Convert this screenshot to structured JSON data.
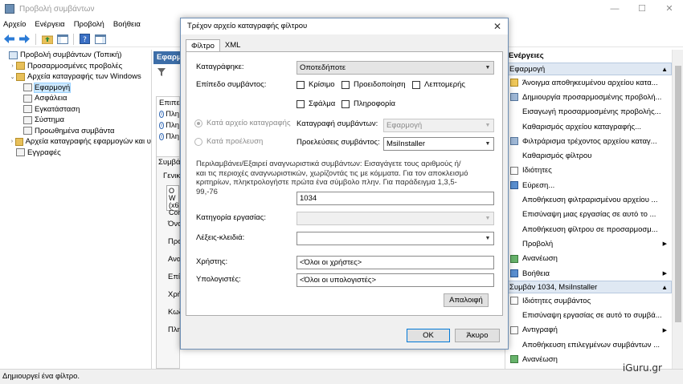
{
  "window": {
    "title": "Προβολή συμβάντων",
    "controls": [
      "—",
      "☐",
      "✕"
    ]
  },
  "menu": [
    "Αρχείο",
    "Ενέργεια",
    "Προβολή",
    "Βοήθεια"
  ],
  "tree": [
    {
      "label": "Προβολή συμβάντων (Τοπική)",
      "indent": 0,
      "arrow": "",
      "icon": "view"
    },
    {
      "label": "Προσαρμοσμένες προβολές",
      "indent": 1,
      "arrow": "›",
      "icon": "folder"
    },
    {
      "label": "Αρχεία καταγραφής των Windows",
      "indent": 1,
      "arrow": "⌄",
      "icon": "folder"
    },
    {
      "label": "Εφαρμογή",
      "indent": 2,
      "arrow": "",
      "icon": "log",
      "selected": true
    },
    {
      "label": "Ασφάλεια",
      "indent": 2,
      "arrow": "",
      "icon": "log"
    },
    {
      "label": "Εγκατάσταση",
      "indent": 2,
      "arrow": "",
      "icon": "log"
    },
    {
      "label": "Σύστημα",
      "indent": 2,
      "arrow": "",
      "icon": "log"
    },
    {
      "label": "Προωθημένα συμβάντα",
      "indent": 2,
      "arrow": "",
      "icon": "log"
    },
    {
      "label": "Αρχεία καταγραφής εφαρμογών και υ",
      "indent": 1,
      "arrow": "›",
      "icon": "folder"
    },
    {
      "label": "Εγγραφές",
      "indent": 1,
      "arrow": "",
      "icon": "log"
    }
  ],
  "middle": {
    "header": "Εφαρμ",
    "col_header": "Επιπεδ",
    "rows": [
      "Πλη",
      "Πλη",
      "Πλη"
    ],
    "detail_header": "Συμβάν",
    "detail_tab": "Γενικ",
    "detail_box": [
      "O W",
      "(x6",
      "Con"
    ],
    "detail_labels": [
      "Όνο",
      "Προ",
      "Ανα",
      "Επίπ",
      "Χρή",
      "Κωδ",
      "Πλη"
    ]
  },
  "actions": {
    "title": "Ενέργειες",
    "section1": "Εφαρμογή",
    "items1": [
      {
        "label": "Άνοιγμα αποθηκευμένου αρχείου κατα...",
        "icon": "open"
      },
      {
        "label": "Δημιουργία προσαρμοσμένης προβολή...",
        "icon": "filter"
      },
      {
        "label": "Εισαγωγή προσαρμοσμένης προβολής...",
        "icon": "none"
      },
      {
        "label": "Καθαρισμός αρχείου καταγραφής...",
        "icon": "none"
      },
      {
        "label": "Φιλτράρισμα τρέχοντος αρχείου καταγ...",
        "icon": "filter"
      },
      {
        "label": "Καθαρισμός φίλτρου",
        "icon": "none"
      },
      {
        "label": "Ιδιότητες",
        "icon": "doc"
      },
      {
        "label": "Εύρεση...",
        "icon": "blue"
      },
      {
        "label": "Αποθήκευση φιλτραρισμένου αρχείου ...",
        "icon": "none"
      },
      {
        "label": "Επισύναψη μιας εργασίας σε αυτό το ...",
        "icon": "none"
      },
      {
        "label": "Αποθήκευση φίλτρου σε προσαρμοσμ...",
        "icon": "none"
      },
      {
        "label": "Προβολή",
        "icon": "none",
        "submenu": true
      },
      {
        "label": "Ανανέωση",
        "icon": "green"
      },
      {
        "label": "Βοήθεια",
        "icon": "blue",
        "submenu": true
      }
    ],
    "section2": "Συμβάν 1034, MsiInstaller",
    "items2": [
      {
        "label": "Ιδιότητες συμβάντος",
        "icon": "doc"
      },
      {
        "label": "Επισύναψη εργασίας σε αυτό το συμβά...",
        "icon": "none"
      },
      {
        "label": "Αντιγραφή",
        "icon": "doc",
        "submenu": true
      },
      {
        "label": "Αποθήκευση επιλεγμένων συμβάντων ...",
        "icon": "none"
      },
      {
        "label": "Ανανέωση",
        "icon": "green"
      }
    ]
  },
  "status": "Δημιουργεί ένα φίλτρο.",
  "watermark": "iGuru.gr",
  "dialog": {
    "title": "Τρέχον αρχείο καταγραφής φίλτρου",
    "close": "✕",
    "tabs": [
      "Φίλτρο",
      "XML"
    ],
    "logged_label": "Καταγράφηκε:",
    "logged_value": "Οποτεδήποτε",
    "level_label": "Επίπεδο συμβάντος:",
    "levels": [
      "Κρίσιμο",
      "Προειδοποίηση",
      "Λεπτομερής",
      "Σφάλμα",
      "Πληροφορία"
    ],
    "by_log_radio": "Κατά αρχείο καταγραφής",
    "by_source_radio": "Κατά προέλευση",
    "event_logs_label": "Καταγραφή συμβάντων:",
    "event_logs_value": "Εφαρμογή",
    "event_sources_label": "Προελεύσεις συμβάντος:",
    "event_sources_value": "MsiInstaller",
    "description": "Περιλαμβάνει/Εξαιρεί αναγνωριστικά συμβάντων: Εισαγάγετε τους αριθμούς ή/και τις περιοχές αναγνωριστικών, χωρίζοντάς τις με κόμματα. Για τον αποκλεισμό κριτηρίων, πληκτρολογήστε πρώτα ένα σύμβολο πλην. Για παράδειγμα 1,3,5-99,-76",
    "event_id_value": "1034",
    "task_category_label": "Κατηγορία εργασίας:",
    "task_category_value": "",
    "keywords_label": "Λέξεις-κλειδιά:",
    "keywords_value": "",
    "user_label": "Χρήστης:",
    "user_value": "<Όλοι οι χρήστες>",
    "computer_label": "Υπολογιστές:",
    "computer_value": "<Όλοι οι υπολογιστές>",
    "clear_button": "Απαλοιφή",
    "ok_button": "OK",
    "cancel_button": "Άκυρο"
  }
}
